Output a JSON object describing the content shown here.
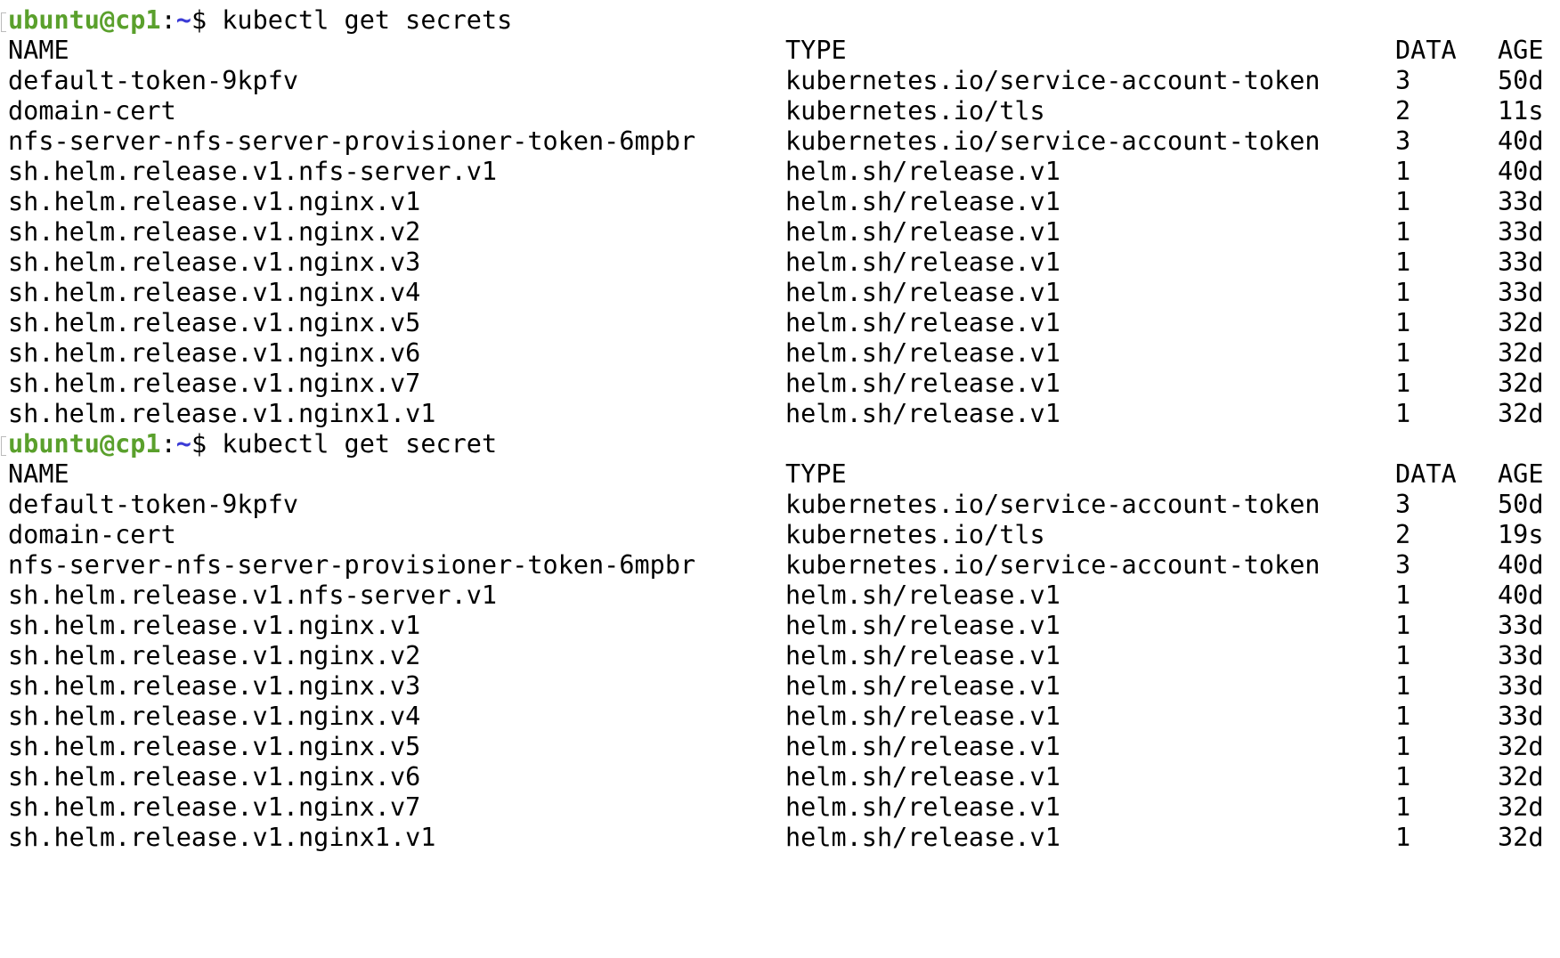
{
  "terminal": {
    "prompt": {
      "user_host": "ubuntu@cp1",
      "separator": ":",
      "path": "~",
      "sign": "$"
    },
    "blocks": [
      {
        "command": " kubectl get secrets",
        "headers": {
          "name": "NAME",
          "type": "TYPE",
          "data": "DATA",
          "age": "AGE"
        },
        "rows": [
          {
            "name": "default-token-9kpfv",
            "type": "kubernetes.io/service-account-token",
            "data": "3",
            "age": "50d"
          },
          {
            "name": "domain-cert",
            "type": "kubernetes.io/tls",
            "data": "2",
            "age": "11s"
          },
          {
            "name": "nfs-server-nfs-server-provisioner-token-6mpbr",
            "type": "kubernetes.io/service-account-token",
            "data": "3",
            "age": "40d"
          },
          {
            "name": "sh.helm.release.v1.nfs-server.v1",
            "type": "helm.sh/release.v1",
            "data": "1",
            "age": "40d"
          },
          {
            "name": "sh.helm.release.v1.nginx.v1",
            "type": "helm.sh/release.v1",
            "data": "1",
            "age": "33d"
          },
          {
            "name": "sh.helm.release.v1.nginx.v2",
            "type": "helm.sh/release.v1",
            "data": "1",
            "age": "33d"
          },
          {
            "name": "sh.helm.release.v1.nginx.v3",
            "type": "helm.sh/release.v1",
            "data": "1",
            "age": "33d"
          },
          {
            "name": "sh.helm.release.v1.nginx.v4",
            "type": "helm.sh/release.v1",
            "data": "1",
            "age": "33d"
          },
          {
            "name": "sh.helm.release.v1.nginx.v5",
            "type": "helm.sh/release.v1",
            "data": "1",
            "age": "32d"
          },
          {
            "name": "sh.helm.release.v1.nginx.v6",
            "type": "helm.sh/release.v1",
            "data": "1",
            "age": "32d"
          },
          {
            "name": "sh.helm.release.v1.nginx.v7",
            "type": "helm.sh/release.v1",
            "data": "1",
            "age": "32d"
          },
          {
            "name": "sh.helm.release.v1.nginx1.v1",
            "type": "helm.sh/release.v1",
            "data": "1",
            "age": "32d"
          }
        ]
      },
      {
        "command": " kubectl get secret",
        "headers": {
          "name": "NAME",
          "type": "TYPE",
          "data": "DATA",
          "age": "AGE"
        },
        "rows": [
          {
            "name": "default-token-9kpfv",
            "type": "kubernetes.io/service-account-token",
            "data": "3",
            "age": "50d"
          },
          {
            "name": "domain-cert",
            "type": "kubernetes.io/tls",
            "data": "2",
            "age": "19s"
          },
          {
            "name": "nfs-server-nfs-server-provisioner-token-6mpbr",
            "type": "kubernetes.io/service-account-token",
            "data": "3",
            "age": "40d"
          },
          {
            "name": "sh.helm.release.v1.nfs-server.v1",
            "type": "helm.sh/release.v1",
            "data": "1",
            "age": "40d"
          },
          {
            "name": "sh.helm.release.v1.nginx.v1",
            "type": "helm.sh/release.v1",
            "data": "1",
            "age": "33d"
          },
          {
            "name": "sh.helm.release.v1.nginx.v2",
            "type": "helm.sh/release.v1",
            "data": "1",
            "age": "33d"
          },
          {
            "name": "sh.helm.release.v1.nginx.v3",
            "type": "helm.sh/release.v1",
            "data": "1",
            "age": "33d"
          },
          {
            "name": "sh.helm.release.v1.nginx.v4",
            "type": "helm.sh/release.v1",
            "data": "1",
            "age": "33d"
          },
          {
            "name": "sh.helm.release.v1.nginx.v5",
            "type": "helm.sh/release.v1",
            "data": "1",
            "age": "32d"
          },
          {
            "name": "sh.helm.release.v1.nginx.v6",
            "type": "helm.sh/release.v1",
            "data": "1",
            "age": "32d"
          },
          {
            "name": "sh.helm.release.v1.nginx.v7",
            "type": "helm.sh/release.v1",
            "data": "1",
            "age": "32d"
          },
          {
            "name": "sh.helm.release.v1.nginx1.v1",
            "type": "helm.sh/release.v1",
            "data": "1",
            "age": "32d"
          }
        ]
      }
    ]
  }
}
